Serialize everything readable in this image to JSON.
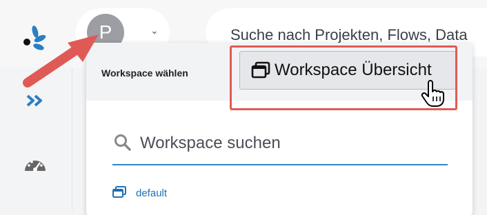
{
  "header": {
    "avatar_initial": "P",
    "search_placeholder": "Suche nach Projekten, Flows, Data"
  },
  "dropdown": {
    "title": "Workspace wählen",
    "overview_button_label": "Workspace Übersicht",
    "search_placeholder": "Workspace suchen",
    "items": [
      {
        "label": "default"
      }
    ]
  },
  "colors": {
    "annotation_red": "#e05a55",
    "link_blue": "#1f6fb5",
    "logo_blue": "#2a7fc3"
  },
  "icons": [
    "logo-icon",
    "chevron-down-icon",
    "expand-icon",
    "dashboard-icon",
    "windows-icon",
    "hand-pointer-icon",
    "search-icon",
    "annotation-arrow"
  ]
}
